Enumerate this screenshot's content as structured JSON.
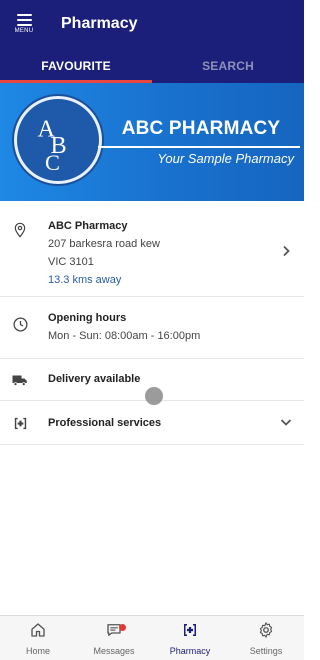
{
  "appbar": {
    "menu_label": "MENU",
    "title": "Pharmacy"
  },
  "tabs": [
    {
      "label": "FAVOURITE",
      "active": true
    },
    {
      "label": "SEARCH",
      "active": false
    }
  ],
  "banner": {
    "logo_text": "ABC",
    "name": "ABC PHARMACY",
    "tagline": "Your Sample Pharmacy"
  },
  "address": {
    "name": "ABC Pharmacy",
    "street": "207 barkesra road kew",
    "suburb": "VIC 3101",
    "distance": "13.3 kms away"
  },
  "hours": {
    "title": "Opening hours",
    "value": "Mon - Sun: 08:00am - 16:00pm"
  },
  "delivery": {
    "label": "Delivery available"
  },
  "professional": {
    "label": "Professional services"
  },
  "bottom_nav": [
    {
      "label": "Home",
      "icon": "home-icon"
    },
    {
      "label": "Messages",
      "icon": "messages-icon",
      "badge": true
    },
    {
      "label": "Pharmacy",
      "icon": "pharmacy-icon",
      "active": true
    },
    {
      "label": "Settings",
      "icon": "settings-icon"
    }
  ],
  "colors": {
    "primary": "#1c1f7a",
    "accent": "#e8463f",
    "banner": "#1e88e5",
    "link": "#2a5fa8"
  }
}
